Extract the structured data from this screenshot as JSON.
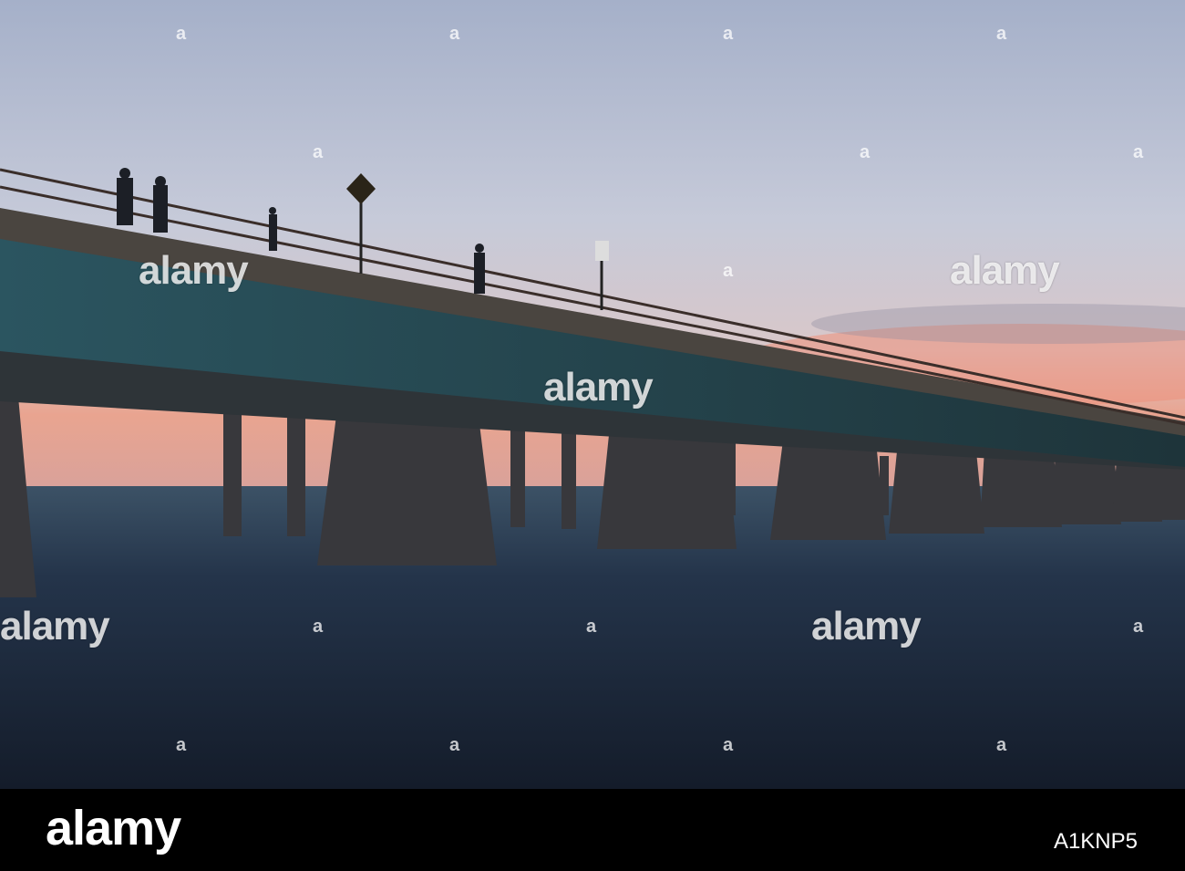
{
  "watermark": {
    "text": "alamy",
    "mark": "a"
  },
  "footer": {
    "logo": "alamy",
    "image_id": "A1KNP5"
  },
  "colors": {
    "sky_top": "#a6b1c9",
    "sky_mid": "#c7c9d8",
    "horizon": "#e79a86",
    "water": "#1d2838",
    "bridge": "#2a3b40",
    "pier": "#35363a"
  }
}
